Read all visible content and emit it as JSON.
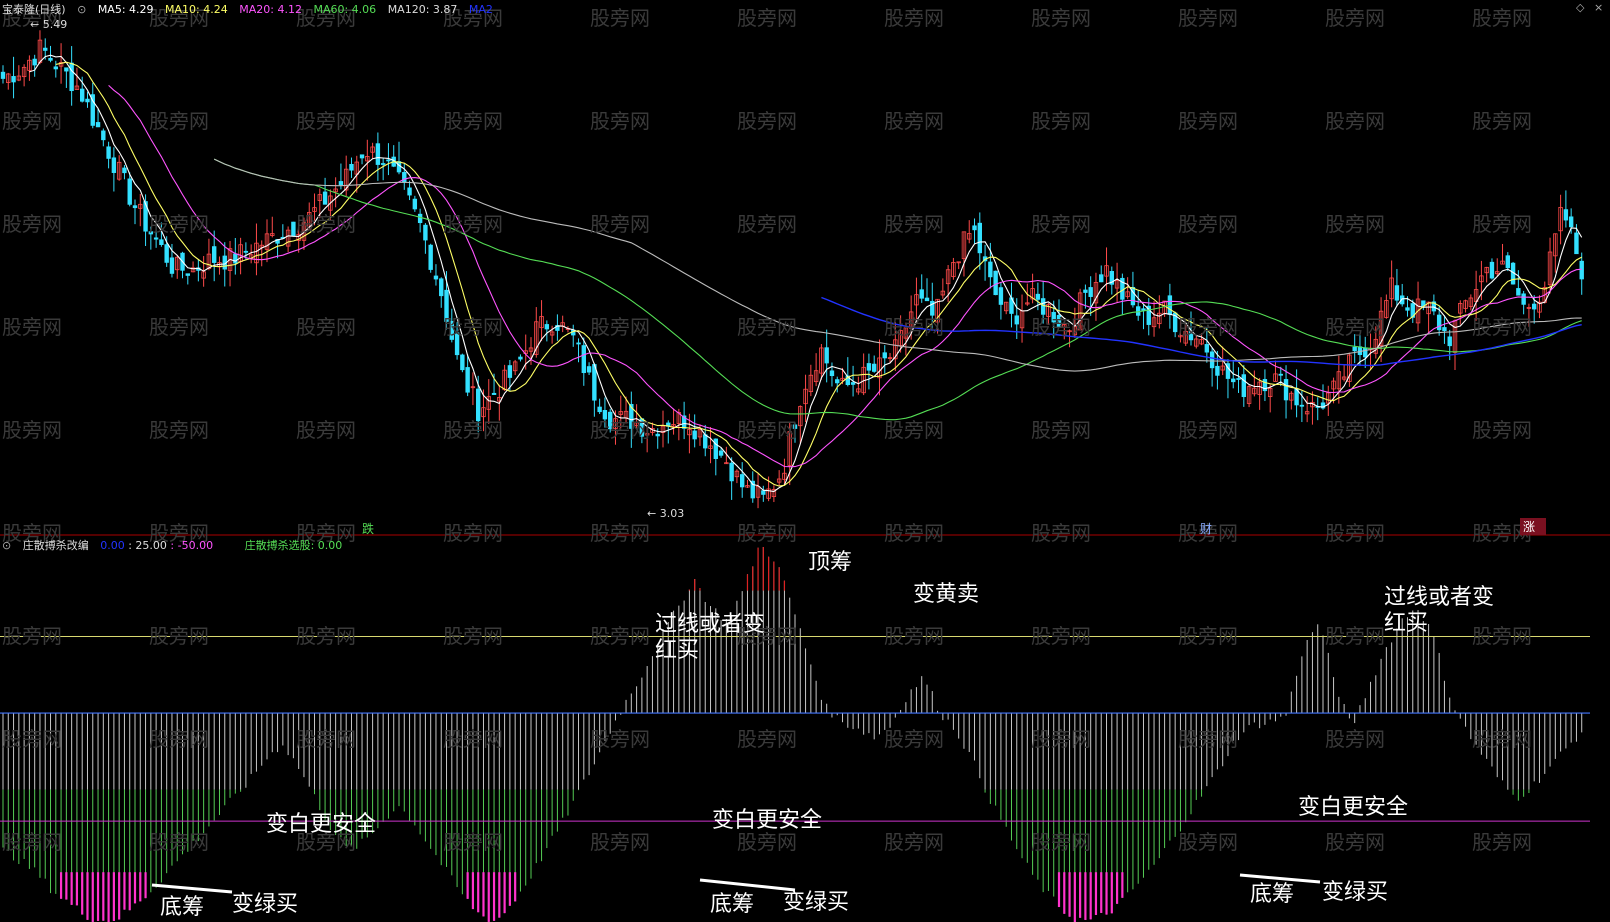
{
  "upper_header": {
    "title": "宝泰隆(日线)",
    "ma5": "MA5: 4.29",
    "ma10": "MA10: 4.24",
    "ma20": "MA20: 4.12",
    "ma60": "MA60: 4.06",
    "ma120": "MA120: 3.87",
    "ma250": "MA2"
  },
  "lower_header": {
    "title": "庄散搏杀改编",
    "v1": "0.00",
    "v2": ": 25.00",
    "v3": ": -50.00",
    "select_label": "庄散搏杀选股: 0.00"
  },
  "price_high_label": "5.49",
  "price_low_label": "3.03",
  "markers": [
    "跌",
    "财",
    "涨"
  ],
  "annotations": {
    "top_chip": "顶筹",
    "turn_yellow_sell": "变黄卖",
    "cross_or_red_1_a": "过线或者变",
    "cross_or_red_1_b": "红买",
    "cross_or_red_2_a": "过线或者变",
    "cross_or_red_2_b": "红买",
    "white_safer_1": "变白更安全",
    "white_safer_2": "变白更安全",
    "white_safer_3": "变白更安全",
    "bottom_chip_1": "底筹",
    "bottom_chip_2": "底筹",
    "bottom_chip_3": "底筹",
    "turn_green_buy_1": "变绿买",
    "turn_green_buy_2": "变绿买",
    "turn_green_buy_3": "变绿买"
  },
  "watermark": "股旁网",
  "colors": {
    "up": "#ff4a4a",
    "down": "#33e0ff",
    "ma5": "#ffffff",
    "ma10": "#ffff66",
    "ma20": "#ff55ff",
    "ma60": "#55dd55",
    "ma120": "#bbbbbb",
    "ma250": "#2233ff",
    "osc_grey": "#c8c8c8",
    "osc_green": "#55cc55",
    "osc_magenta": "#ff33cc",
    "osc_red": "#dd2222",
    "level_yellow": "#d8d870",
    "level_blue": "#4477ff",
    "level_magenta": "#cc33cc",
    "divider": "#aa0000"
  },
  "chart_data": [
    {
      "type": "candlestick",
      "title": "宝泰隆(日线)",
      "ylim": [
        3.0,
        5.55
      ],
      "high": 5.49,
      "low": 3.03,
      "ma_last": {
        "MA5": 4.29,
        "MA10": 4.24,
        "MA20": 4.12,
        "MA60": 4.06,
        "MA120": 3.87
      },
      "close_path": [
        5.25,
        5.3,
        5.4,
        5.3,
        5.2,
        5.0,
        4.8,
        4.6,
        4.45,
        4.3,
        4.3,
        4.35,
        4.35,
        4.4,
        4.45,
        4.5,
        4.55,
        4.65,
        4.75,
        4.9,
        4.85,
        4.7,
        4.5,
        4.2,
        3.8,
        3.6,
        3.7,
        3.8,
        4.0,
        4.05,
        3.95,
        3.7,
        3.55,
        3.55,
        3.5,
        3.55,
        3.55,
        3.45,
        3.35,
        3.2,
        3.15,
        3.3,
        3.7,
        3.9,
        3.7,
        3.75,
        3.8,
        3.9,
        4.15,
        4.05,
        4.35,
        4.5,
        4.2,
        4.05,
        4.15,
        4.1,
        4.0,
        4.2,
        4.3,
        4.15,
        4.05,
        4.1,
        4.0,
        3.95,
        3.8,
        3.7,
        3.75,
        3.75,
        3.65,
        3.6,
        3.7,
        3.85,
        3.95,
        4.2,
        4.1,
        4.1,
        3.95,
        4.15,
        4.3,
        4.3,
        4.1,
        4.2,
        4.6,
        4.3
      ]
    },
    {
      "type": "bar",
      "title": "庄散搏杀改编",
      "ylim": [
        -65,
        50
      ],
      "levels": [
        40,
        25,
        0,
        -50
      ],
      "values": [
        -45,
        -48,
        -52,
        -58,
        -62,
        -66,
        -68,
        -67,
        -63,
        -58,
        -52,
        -46,
        -40,
        -34,
        -28,
        -22,
        -15,
        -10,
        -18,
        -28,
        -38,
        -45,
        -42,
        -36,
        -30,
        -36,
        -44,
        -52,
        -60,
        -66,
        -68,
        -62,
        -54,
        -45,
        -36,
        -26,
        -16,
        -5,
        5,
        14,
        25,
        34,
        44,
        35,
        30,
        40,
        55,
        50,
        35,
        18,
        2,
        -3,
        -5,
        -8,
        -4,
        6,
        12,
        0,
        -6,
        -16,
        -28,
        -38,
        -48,
        -56,
        -62,
        -67,
        -68,
        -66,
        -62,
        -56,
        -50,
        -42,
        -34,
        -26,
        -18,
        -8,
        -4,
        -3,
        -1,
        20,
        30,
        10,
        -5,
        8,
        20,
        30,
        35,
        25,
        5,
        -6,
        -14,
        -22,
        -28,
        -24,
        -18,
        -12,
        -6
      ]
    }
  ]
}
